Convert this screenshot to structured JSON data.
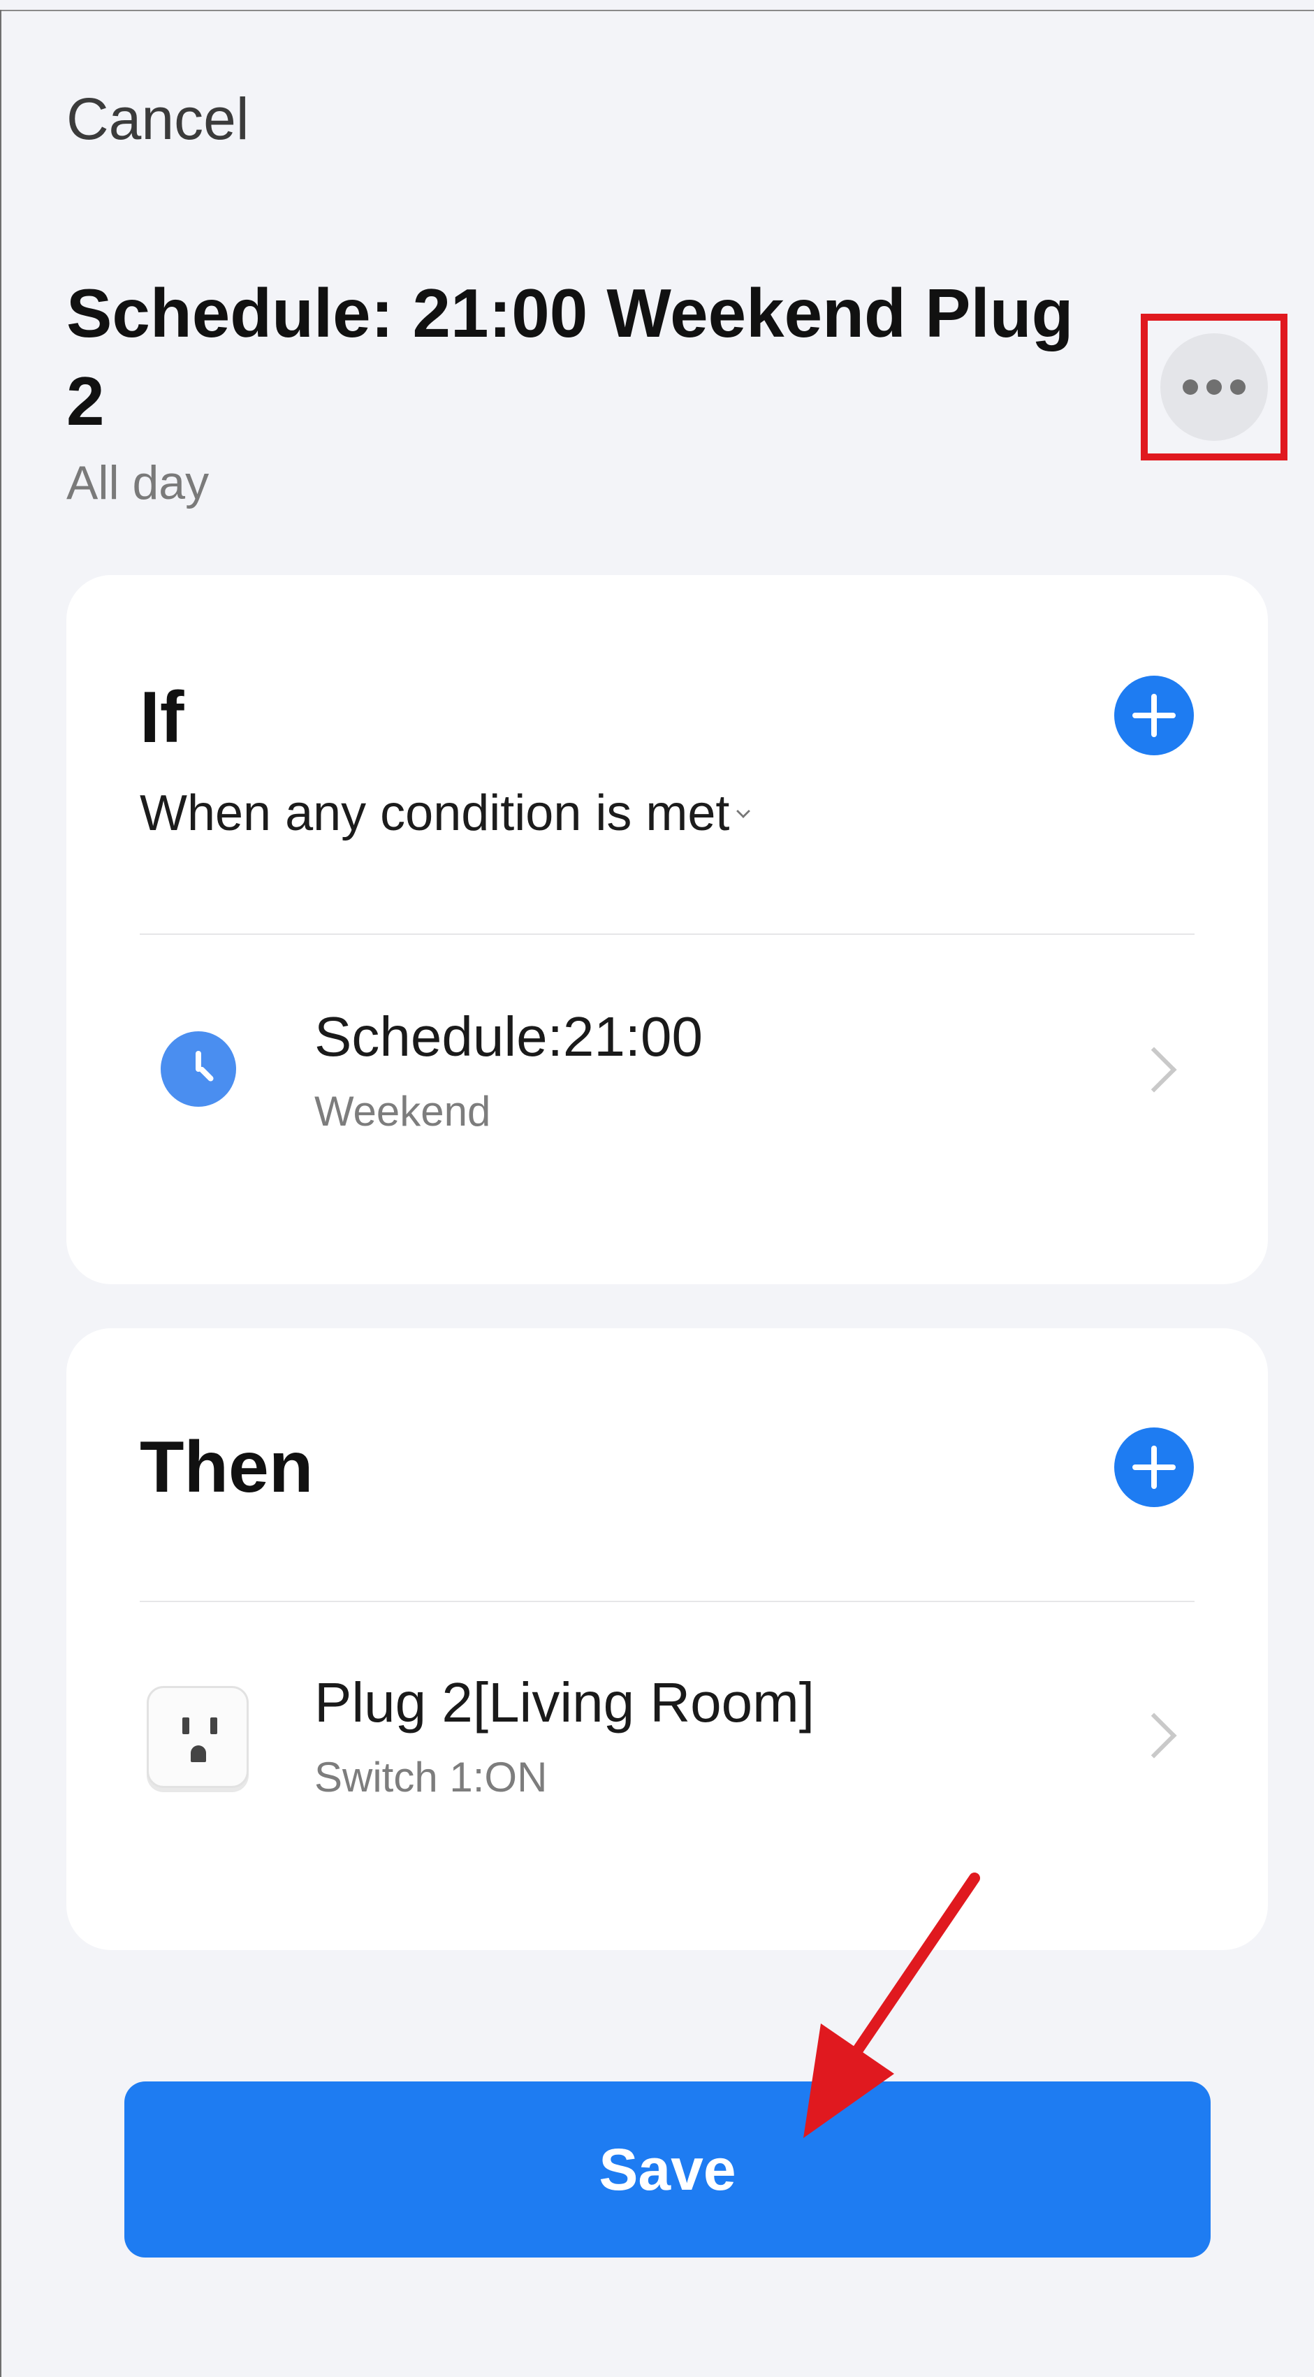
{
  "header": {
    "cancel_label": "Cancel",
    "title": "Schedule: 21:00 Weekend Plug 2",
    "subtitle": "All day",
    "more_icon": "more-horizontal-icon"
  },
  "if_section": {
    "heading": "If",
    "condition_mode": "When any condition is met",
    "add_icon": "plus-icon",
    "items": [
      {
        "icon": "clock-icon",
        "title": "Schedule:21:00",
        "subtitle": "Weekend"
      }
    ]
  },
  "then_section": {
    "heading": "Then",
    "add_icon": "plus-icon",
    "items": [
      {
        "icon": "plug-icon",
        "title": "Plug 2[Living Room]",
        "subtitle": "Switch 1:ON"
      }
    ]
  },
  "footer": {
    "save_label": "Save"
  },
  "annotations": {
    "highlight_color": "#e0191f",
    "arrow_color": "#e0191f"
  },
  "colors": {
    "accent": "#1e7cf2",
    "background": "#f3f4f8"
  }
}
